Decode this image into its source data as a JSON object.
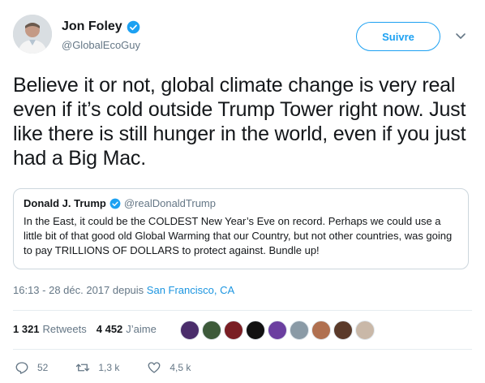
{
  "author": {
    "display_name": "Jon Foley",
    "handle": "@GlobalEcoGuy",
    "avatar_icon": "user-avatar",
    "verified_icon": "verified-badge-icon"
  },
  "follow_button": {
    "label": "Suivre"
  },
  "more_icon": "chevron-down-icon",
  "tweet_text": "Believe it or not, global climate change is very real even if it’s cold outside Trump Tower right now. Just like there is still hunger in the world, even if you just had a Big Mac.",
  "quoted_tweet": {
    "display_name": "Donald J. Trump",
    "handle": "@realDonaldTrump",
    "text": "In the East, it could be the COLDEST New Year’s Eve on record. Perhaps we could use a little bit of that good old Global Warming that our Country, but not other countries, was going to pay TRILLIONS OF DOLLARS to protect against. Bundle up!"
  },
  "meta": {
    "timestamp": "16:13 - 28 déc. 2017 depuis ",
    "location": "San Francisco, CA"
  },
  "stats": {
    "retweets_count": "1 321",
    "retweets_label": "Retweets",
    "likes_count": "4 452",
    "likes_label": "J’aime"
  },
  "liker_avatars": [
    "#4a2d6b",
    "#3d5a3a",
    "#7a1e24",
    "#111111",
    "#6b3fa0",
    "#8a9aa6",
    "#b07050",
    "#5a3a2a",
    "#c9b8a8"
  ],
  "actions": {
    "replies": "52",
    "retweets": "1,3 k",
    "likes": "4,5 k"
  },
  "colors": {
    "accent": "#1da1f2",
    "text": "#14171a",
    "muted": "#657786",
    "border": "#ccd6dd"
  }
}
